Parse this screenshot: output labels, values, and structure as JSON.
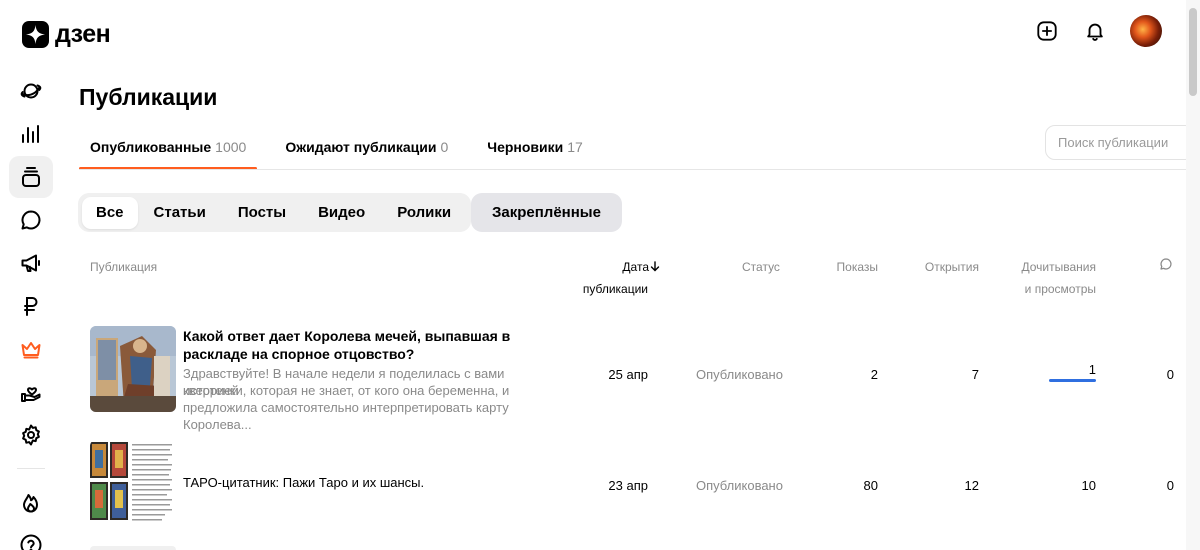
{
  "app": {
    "logo_text": "дзен"
  },
  "top_actions": {
    "create_icon": "plus-square-icon",
    "notifications_icon": "bell-icon"
  },
  "sidebar": {
    "items": [
      {
        "icon": "planet-icon",
        "active": false
      },
      {
        "icon": "bar-chart-icon",
        "active": false
      },
      {
        "icon": "publications-stack-icon",
        "active": true
      },
      {
        "icon": "comment-bubble-icon",
        "active": false
      },
      {
        "icon": "megaphone-icon",
        "active": false
      },
      {
        "icon": "ruble-icon",
        "active": false
      },
      {
        "icon": "crown-icon",
        "active": false,
        "color": "#ff5d1f"
      },
      {
        "icon": "hand-heart-icon",
        "active": false
      },
      {
        "icon": "gear-icon",
        "active": false
      },
      {
        "icon": "flame-icon",
        "active": false
      },
      {
        "icon": "help-icon",
        "active": false
      }
    ]
  },
  "page": {
    "title": "Публикации"
  },
  "tabs": [
    {
      "label": "Опубликованные",
      "count": "1000",
      "active": true
    },
    {
      "label": "Ожидают публикации",
      "count": "0",
      "active": false
    },
    {
      "label": "Черновики",
      "count": "17",
      "active": false
    }
  ],
  "search": {
    "placeholder": "Поиск публикации"
  },
  "filters": {
    "chips": [
      "Все",
      "Статьи",
      "Посты",
      "Видео",
      "Ролики"
    ],
    "selected": "Все",
    "pinned_label": "Закреплённые"
  },
  "table": {
    "headers": {
      "publication": "Публикация",
      "date_line1": "Дата",
      "date_line2": "публикации",
      "status": "Статус",
      "impressions": "Показы",
      "opens": "Открытия",
      "reads_line1": "Дочитывания",
      "reads_line2": "и просмотры",
      "comments_icon": "comment-icon"
    },
    "sort": {
      "column": "date",
      "direction": "desc",
      "icon": "arrow-down-icon"
    },
    "rows": [
      {
        "title_line1": "Какой ответ дает Королева мечей, выпавшая в",
        "title_line2": "раскладе на спорное отцовство?",
        "excerpt_line1": "Здравствуйте! В начале недели я поделилась с вами историей",
        "excerpt_line2": "квертенки, которая не знает, от кого она беременна, и",
        "excerpt_line3": "предложила самостоятельно интерпретировать карту Королева...",
        "date": "25 апр",
        "status": "Опубликовано",
        "impressions": "2",
        "opens": "7",
        "reads": "1",
        "reads_progress": 1.0,
        "comments": "0"
      },
      {
        "title_line1": "ТАРО-цитатник: Пажи Таро и их шансы.",
        "date": "23 апр",
        "status": "Опубликовано",
        "impressions": "80",
        "opens": "12",
        "reads": "10",
        "comments": "0"
      }
    ]
  },
  "colors": {
    "accent": "#ff5d1f",
    "progress": "#2f6fe0",
    "muted_text": "#8a8a8a"
  }
}
